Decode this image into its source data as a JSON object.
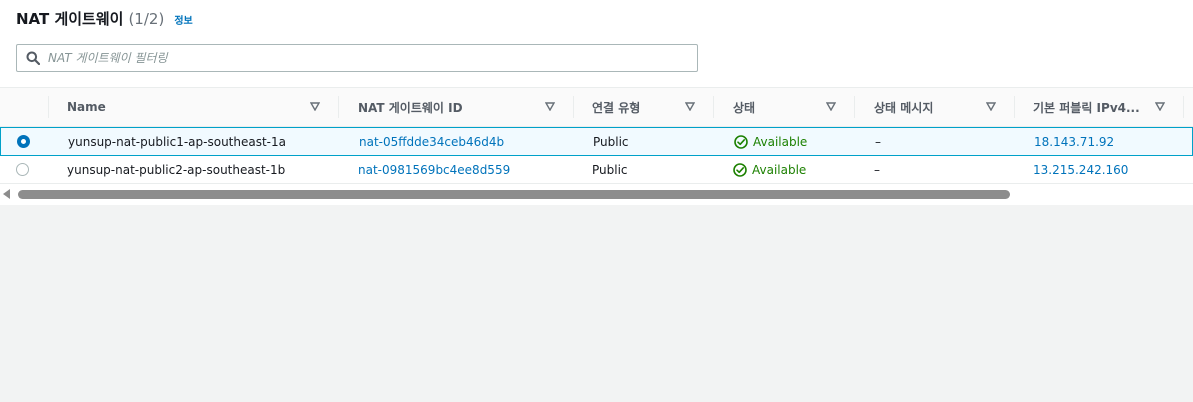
{
  "header": {
    "title": "NAT 게이트웨이",
    "count": "(1/2)",
    "info_label": "정보"
  },
  "search": {
    "placeholder": "NAT 게이트웨이 필터링",
    "value": ""
  },
  "table": {
    "columns": [
      "Name",
      "NAT 게이트웨이 ID",
      "연결 유형",
      "상태",
      "상태 메시지",
      "기본 퍼블릭 IPv4..."
    ],
    "rows": [
      {
        "selected": true,
        "name": "yunsup-nat-public1-ap-southeast-1a",
        "id": "nat-05ffdde34ceb46d4b",
        "type": "Public",
        "state": "Available",
        "message": "–",
        "ip": "18.143.71.92"
      },
      {
        "selected": false,
        "name": "yunsup-nat-public2-ap-southeast-1b",
        "id": "nat-0981569bc4ee8d559",
        "type": "Public",
        "state": "Available",
        "message": "–",
        "ip": "13.215.242.160"
      }
    ]
  },
  "colors": {
    "link": "#0073bb",
    "available": "#1d8102",
    "selected_border": "#00a1c9"
  },
  "icons": {
    "search": "search-icon",
    "sort": "sort-caret-down-icon",
    "status": "check-circle-icon",
    "scroll_left": "scroll-left-arrow-icon"
  }
}
